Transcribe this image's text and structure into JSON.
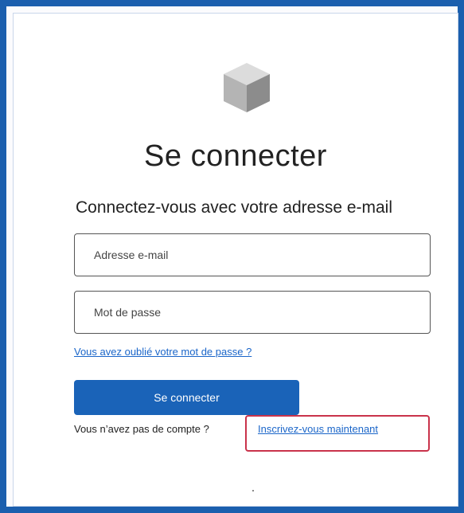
{
  "login": {
    "title": "Se connecter",
    "subtitle": "Connectez-vous avec votre adresse e-mail",
    "email_placeholder": "Adresse e-mail",
    "password_placeholder": "Mot de passe",
    "forgot_password": "Vous avez oublié votre mot de passe ?",
    "submit_label": "Se connecter",
    "no_account_text": "Vous n’avez pas de compte ?",
    "signup_link": "Inscrivez-vous maintenant"
  },
  "icons": {
    "logo": "cube-icon"
  },
  "colors": {
    "frame": "#1b5fae",
    "primary_button": "#1a63b8",
    "link": "#1b66c9",
    "highlight_box": "#c9334b"
  }
}
